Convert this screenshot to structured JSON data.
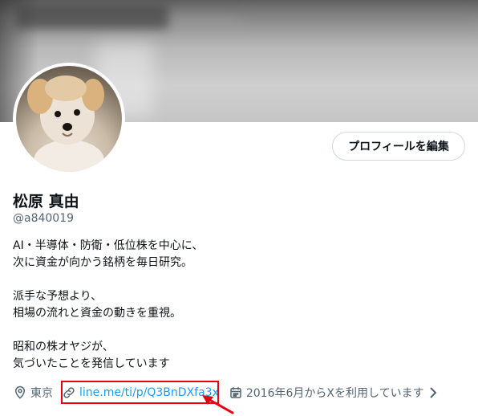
{
  "profile": {
    "display_name": "松原 真由",
    "handle": "@a840019",
    "edit_button_label": "プロフィールを編集",
    "bio_lines": [
      "AI・半導体・防衛・低位株を中心に、",
      "次に資金が向かう銘柄を毎日研究。",
      "",
      "派手な予想より、",
      "相場の流れと資金の動きを重視。",
      "",
      "昭和の株オヤジが、",
      "気づいたことを発信しています"
    ],
    "location": "東京",
    "link": "line.me/ti/p/Q3BnDXfa3x",
    "joined": "2016年6月からXを利用しています"
  },
  "icons": {
    "location": "location-pin-icon",
    "link": "link-icon",
    "calendar": "calendar-icon",
    "chevron": "chevron-right-icon"
  },
  "colors": {
    "link": "#1d9bf0",
    "secondary_text": "#536471",
    "highlight": "#e60012"
  }
}
